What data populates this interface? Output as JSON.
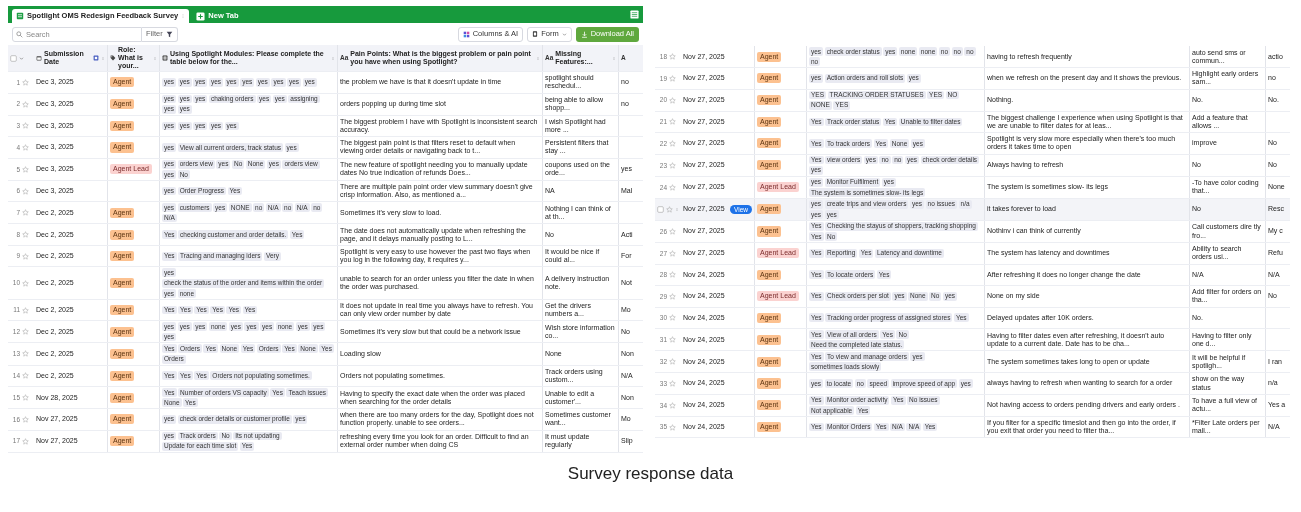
{
  "left_panel": {
    "tabs": [
      {
        "label": "Spotlight OMS Redesign Feedback Survey",
        "selected": true
      }
    ],
    "new_tab": "New Tab",
    "toolbar": {
      "search": {
        "placeholder": "Search"
      },
      "filter": "Filter",
      "columns_button": "Columns & AI",
      "form_button": "Form",
      "download_button": "Download All"
    },
    "select_all": {
      "checked": false
    },
    "columns": [
      {
        "kind": "date",
        "label": "Submission Date"
      },
      {
        "kind": "tag",
        "label": "Role: What is your..."
      },
      {
        "kind": "table",
        "label": "Using Spotlight Modules: Please complete the table below for the..."
      },
      {
        "kind": "text",
        "glyph": "Aa",
        "label": "Pain Points: What is the biggest problem or pain point you have when using Spotlight?"
      },
      {
        "kind": "text",
        "glyph": "Aa",
        "label": "Missing Features:..."
      },
      {
        "kind": "text",
        "glyph": "A"
      }
    ],
    "rows": [
      {
        "n": "1",
        "date": "Dec 3, 2025",
        "role": {
          "text": "Agent",
          "kind": "agent"
        },
        "modules": [
          "yes",
          "yes",
          "yes",
          "yes",
          "yes",
          "yes",
          "yes",
          "yes",
          "yes",
          "yes"
        ],
        "pain": "the problem we have is that it doesn't update in time",
        "missing": "spotlight should reschedul...",
        "col7": "no"
      },
      {
        "n": "2",
        "date": "Dec 3, 2025",
        "role": {
          "text": "Agent",
          "kind": "agent"
        },
        "modules": [
          "yes",
          "yes",
          "yes",
          "chaking orders",
          "yes",
          "yes",
          "assigning",
          "yes",
          "yes"
        ],
        "pain": "orders popping up during time slot",
        "missing": "being able to allow shopp...",
        "col7": "no"
      },
      {
        "n": "3",
        "date": "Dec 3, 2025",
        "role": {
          "text": "Agent",
          "kind": "agent"
        },
        "modules": [
          "yes",
          "yes",
          "yes",
          "yes",
          "yes"
        ],
        "pain": "The biggest problem I have with Spotlight is inconsistent search accuracy.",
        "missing": "I wish Spotlight had more ..."
      },
      {
        "n": "4",
        "date": "Dec 3, 2025",
        "role": {
          "text": "Agent",
          "kind": "agent"
        },
        "modules": [
          "yes",
          "View all current orders, track status",
          "yes"
        ],
        "pain": "The biggest pain point is that filters reset to default when viewing order details or navigating back to t...",
        "missing": "Persistent filters that stay ..."
      },
      {
        "n": "5",
        "date": "Dec 3, 2025",
        "role": {
          "text": "Agent Lead",
          "kind": "lead"
        },
        "modules": [
          "yes",
          "orders view",
          "yes",
          "No",
          "None",
          "yes",
          "orders view",
          "yes",
          "No"
        ],
        "pain": "The new feature of spotlight needing you to manually update dates No true indication of refunds Does...",
        "missing": "coupons used on the orde...",
        "col7": "yes"
      },
      {
        "n": "6",
        "date": "Dec 3, 2025",
        "modules": [
          "yes",
          "Order Progress",
          "Yes"
        ],
        "pain": "There are multiple pain point order view summary doesn't give crisp information. Also, as mentioned a...",
        "missing": "NA",
        "col7": "Mal"
      },
      {
        "n": "7",
        "date": "Dec 2, 2025",
        "role": {
          "text": "Agent",
          "kind": "agent"
        },
        "modules": [
          "yes",
          "customers",
          "yes",
          "NONE",
          "no",
          "N/A",
          "no",
          "N/A",
          "no",
          "N/A"
        ],
        "pain": "Sometimes it's very slow to load.",
        "missing": "Nothing I can think of at th..."
      },
      {
        "n": "8",
        "date": "Dec 2, 2025",
        "role": {
          "text": "Agent",
          "kind": "agent"
        },
        "modules": [
          "Yes",
          "checking customer and order details.",
          "Yes"
        ],
        "pain": "The date does not automatically update when refreshing the page, and it delays manually posting to L...",
        "missing": "No",
        "col7": "Acti"
      },
      {
        "n": "9",
        "date": "Dec 2, 2025",
        "role": {
          "text": "Agent",
          "kind": "agent"
        },
        "modules": [
          "Yes",
          "Tracing and managing iders",
          "Very"
        ],
        "pain": "Spotlight is very easy to use however the past two flays when you log in the following day, it requires y...",
        "missing": "It would be nice if could al...",
        "col7": "For"
      },
      {
        "n": "10",
        "date": "Dec 2, 2025",
        "role": {
          "text": "Agent",
          "kind": "agent"
        },
        "modules": [
          "yes",
          "check the status of the order and items within the order",
          "yes",
          "none"
        ],
        "pain": "unable to search for an order unless you filter the date in when the order was purchased.",
        "missing": "A delivery instruction note.",
        "col7": "Not"
      },
      {
        "n": "11",
        "date": "Dec 2, 2025",
        "role": {
          "text": "Agent",
          "kind": "agent"
        },
        "modules": [
          "Yes",
          "Yes",
          "Yes",
          "Yes",
          "Yes",
          "Yes"
        ],
        "pain": "It does not update in real time you always have to refresh. You can only view order number by date",
        "missing": "Get the drivers numbers a...",
        "col7": "Mo"
      },
      {
        "n": "12",
        "date": "Dec 2, 2025",
        "role": {
          "text": "Agent",
          "kind": "agent"
        },
        "modules": [
          "yes",
          "yes",
          "yes",
          "none",
          "yes",
          "yes",
          "yes",
          "none",
          "yes",
          "yes",
          "yes"
        ],
        "pain": "Sometimes it's very slow but that could be a network issue",
        "missing": "Wish store information co...",
        "col7": "No"
      },
      {
        "n": "13",
        "date": "Dec 2, 2025",
        "role": {
          "text": "Agent",
          "kind": "agent"
        },
        "modules": [
          "Yes",
          "Orders",
          "Yes",
          "None",
          "Yes",
          "Orders",
          "Yes",
          "None",
          "Yes",
          "Orders"
        ],
        "pain": "Loading slow",
        "missing": "None",
        "col7": "Non"
      },
      {
        "n": "14",
        "date": "Dec 2, 2025",
        "role": {
          "text": "Agent",
          "kind": "agent"
        },
        "modules": [
          "Yes",
          "Yes",
          "Yes",
          "Orders not populating sometimes."
        ],
        "pain": "Orders not populating sometimes.",
        "missing": "Track orders using custom...",
        "col7": "N/A"
      },
      {
        "n": "15",
        "date": "Nov 28, 2025",
        "role": {
          "text": "Agent",
          "kind": "agent"
        },
        "modules": [
          "Yes",
          "Number of orders VS capacity",
          "Yes",
          "Teach issues",
          "None",
          "Yes"
        ],
        "pain": "Having to specify the exact date when the order was placed when searching for the order details",
        "missing": "Unable to edit a customer'...",
        "col7": "Non"
      },
      {
        "n": "16",
        "date": "Nov 27, 2025",
        "role": {
          "text": "Agent",
          "kind": "agent"
        },
        "modules": [
          "yes",
          "check order details or customer profile",
          "yes"
        ],
        "pain": "when there are too many orders for the day, Spotlight does not function properly. unable to see orders...",
        "missing": "Sometimes customer want...",
        "col7": "Mo"
      },
      {
        "n": "17",
        "date": "Nov 27, 2025",
        "role": {
          "text": "Agent",
          "kind": "agent"
        },
        "modules": [
          "yes",
          "Track orders",
          "No",
          "Its not updating",
          "Update for each time slot",
          "Yes"
        ],
        "pain": "refreshing every time you look for an order. Difficult to find an external order number when doing CS",
        "missing": "It must update regularly",
        "col7": "Slip"
      }
    ]
  },
  "right_panel": {
    "rows": [
      {
        "n": "18",
        "hovered": false,
        "date": "Nov 27, 2025",
        "role": {
          "text": "Agent",
          "kind": "agent"
        },
        "modules": [
          "yes",
          "check order status",
          "yes",
          "none",
          "none",
          "no",
          "no",
          "no",
          "no"
        ],
        "pain": "having to refresh frequently",
        "missing": "auto send sms or commun...",
        "col7": "actio"
      },
      {
        "n": "19",
        "hovered": false,
        "date": "Nov 27, 2025",
        "role": {
          "text": "Agent",
          "kind": "agent"
        },
        "modules": [
          "yes",
          "Action orders and roll slots",
          "yes"
        ],
        "pain": "when we refresh on the present day and it shows the previous.",
        "missing": "Highlight early orders sam...",
        "col7": "no"
      },
      {
        "n": "20",
        "hovered": false,
        "date": "Nov 27, 2025",
        "role": {
          "text": "Agent",
          "kind": "agent"
        },
        "modules": [
          "YES",
          "TRACKING ORDER STATUSES",
          "YES",
          "NO",
          "NONE",
          "YES"
        ],
        "pain": "Nothing.",
        "missing": "No.",
        "col7": "No."
      },
      {
        "n": "21",
        "hovered": false,
        "date": "Nov 27, 2025",
        "role": {
          "text": "Agent",
          "kind": "agent"
        },
        "modules": [
          "Yes",
          "Track order status",
          "Yes",
          "Unable to filter dates"
        ],
        "pain": "The biggest challenge I experience when using Spotlight is that we are unable to filter dates for at leas...",
        "missing": "Add a feature that allows ..."
      },
      {
        "n": "22",
        "hovered": false,
        "date": "Nov 27, 2025",
        "role": {
          "text": "Agent",
          "kind": "agent"
        },
        "modules": [
          "Yes",
          "To track orders",
          "Yes",
          "None",
          "yes"
        ],
        "pain": "Spotlight is very slow more especially when there's too much orders it takes time to open",
        "missing": "improve",
        "col7": "No"
      },
      {
        "n": "23",
        "hovered": false,
        "date": "Nov 27, 2025",
        "role": {
          "text": "Agent",
          "kind": "agent"
        },
        "modules": [
          "Yes",
          "view orders",
          "yes",
          "no",
          "no",
          "yes",
          "check order details",
          "yes"
        ],
        "pain": "Always having to refresh",
        "missing": "No",
        "col7": "No"
      },
      {
        "n": "24",
        "hovered": false,
        "date": "Nov 27, 2025",
        "role": {
          "text": "Agent Lead",
          "kind": "lead"
        },
        "modules": [
          "yes",
          "Monitor Fulfilment",
          "yes",
          "The system is sometimes slow- its legs"
        ],
        "pain": "The system is sometimes slow- its legs",
        "missing": "-To have color coding that...",
        "col7": "None"
      },
      {
        "hovered": true,
        "checked": false,
        "view_button": "View",
        "date": "Nov 27, 2025",
        "role": {
          "text": "Agent",
          "kind": "agent"
        },
        "modules": [
          "yes",
          "create trips and view orders",
          "yes",
          "no issues",
          "n/a",
          "yes",
          "yes"
        ],
        "pain": "it takes forever to load",
        "missing": "No",
        "col7": "Resc"
      },
      {
        "n": "26",
        "hovered": false,
        "date": "Nov 27, 2025",
        "role": {
          "text": "Agent",
          "kind": "agent"
        },
        "modules": [
          "Yes",
          "Checking the stayus of shoppers, tracking shopping",
          "Yes",
          "No"
        ],
        "pain": "Nothinv i can think of currently",
        "missing": "Call customers dire tly fro...",
        "col7": "My c"
      },
      {
        "n": "27",
        "hovered": false,
        "date": "Nov 27, 2025",
        "role": {
          "text": "Agent Lead",
          "kind": "lead"
        },
        "modules": [
          "Yes",
          "Reporting",
          "Yes",
          "Latency and downtime"
        ],
        "pain": "The system has latency and downtimes",
        "missing": "Ability to search orders usi...",
        "col7": "Refu"
      },
      {
        "n": "28",
        "hovered": false,
        "date": "Nov 24, 2025",
        "role": {
          "text": "Agent",
          "kind": "agent"
        },
        "modules": [
          "Yes",
          "To locate orders",
          "Yes"
        ],
        "pain": "After refreshing it does no longer change the date",
        "missing": "N/A",
        "col7": "N/A"
      },
      {
        "n": "29",
        "hovered": false,
        "date": "Nov 24, 2025",
        "role": {
          "text": "Agent Lead",
          "kind": "lead"
        },
        "modules": [
          "Yes",
          "Check orders per slot",
          "yes",
          "None",
          "No",
          "yes"
        ],
        "pain": "None on my side",
        "missing": "Add filter for orders on tha...",
        "col7": "No"
      },
      {
        "n": "30",
        "hovered": false,
        "date": "Nov 24, 2025",
        "role": {
          "text": "Agent",
          "kind": "agent"
        },
        "modules": [
          "Yes",
          "Tracking order progress of assigned stores",
          "Yes"
        ],
        "pain": "Delayed updates after 10K orders.",
        "missing": "No."
      },
      {
        "n": "31",
        "hovered": false,
        "date": "Nov 24, 2025",
        "role": {
          "text": "Agent",
          "kind": "agent"
        },
        "modules": [
          "Yes",
          "View of all orders",
          "Yes",
          "No",
          "Need the completed late status."
        ],
        "pain": "Having to filter dates even after refreshing, it doesn't auto update to a current date. Date has to be cha...",
        "missing": "Having to filter only one d..."
      },
      {
        "n": "32",
        "hovered": false,
        "date": "Nov 24, 2025",
        "role": {
          "text": "Agent",
          "kind": "agent"
        },
        "modules": [
          "Yes",
          "To view and manage orders",
          "yes",
          "sometimes loads slowly"
        ],
        "pain": "The system sometimes takes long to open or update",
        "missing": "It will be helpful if spotligh...",
        "col7": "I ran"
      },
      {
        "n": "33",
        "hovered": false,
        "date": "Nov 24, 2025",
        "role": {
          "text": "Agent",
          "kind": "agent"
        },
        "modules": [
          "yes",
          "to locate",
          "no",
          "speed",
          "improve speed of app",
          "yes"
        ],
        "pain": "always having to refresh when wanting to search for a order",
        "missing": "show on the way status",
        "col7": "n/a"
      },
      {
        "n": "34",
        "hovered": false,
        "date": "Nov 24, 2025",
        "role": {
          "text": "Agent",
          "kind": "agent"
        },
        "modules": [
          "Yes",
          "Monitor order activity",
          "Yes",
          "No issues",
          "Not applicable",
          "Yes"
        ],
        "pain": "Not having access to orders pending drivers and early orders .",
        "missing": "To have a full view of actu...",
        "col7": "Yes a"
      },
      {
        "n": "35",
        "hovered": false,
        "date": "Nov 24, 2025",
        "role": {
          "text": "Agent",
          "kind": "agent"
        },
        "modules": [
          "Yes",
          "Monitor Orders",
          "Yes",
          "N/A",
          "N/A",
          "Yes"
        ],
        "pain": "If you filter for a specific timeslot and then go into the order, if you exit that order you need to filter tha...",
        "missing": "*Filter Late orders per mall...",
        "col7": "N/A"
      }
    ]
  },
  "caption": "Survey response data"
}
